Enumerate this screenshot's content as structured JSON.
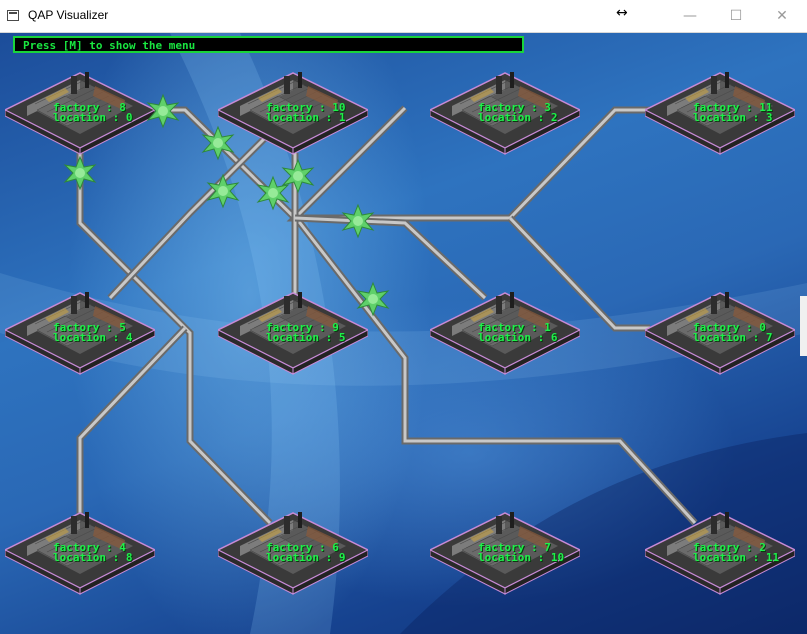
{
  "window": {
    "title": "QAP Visualizer",
    "minimize_icon": "minimize-icon",
    "maximize_icon": "maximize-icon",
    "close_icon": "close-icon",
    "cursor_icon": "resize-horizontal-cursor-icon"
  },
  "hint": {
    "text": "Press [M] to show the menu"
  },
  "factory_prefix": "factory : ",
  "location_prefix": "location : ",
  "grid": [
    {
      "factory": "8",
      "location": "0"
    },
    {
      "factory": "10",
      "location": "1"
    },
    {
      "factory": "3",
      "location": "2"
    },
    {
      "factory": "11",
      "location": "3"
    },
    {
      "factory": "5",
      "location": "4"
    },
    {
      "factory": "9",
      "location": "5"
    },
    {
      "factory": "1",
      "location": "6"
    },
    {
      "factory": "0",
      "location": "7"
    },
    {
      "factory": "4",
      "location": "8"
    },
    {
      "factory": "6",
      "location": "9"
    },
    {
      "factory": "7",
      "location": "10"
    },
    {
      "factory": "2",
      "location": "11"
    }
  ],
  "colors": {
    "hint_text": "#19e640",
    "label_text": "#1ef04a",
    "road": "#c8c8c8"
  }
}
